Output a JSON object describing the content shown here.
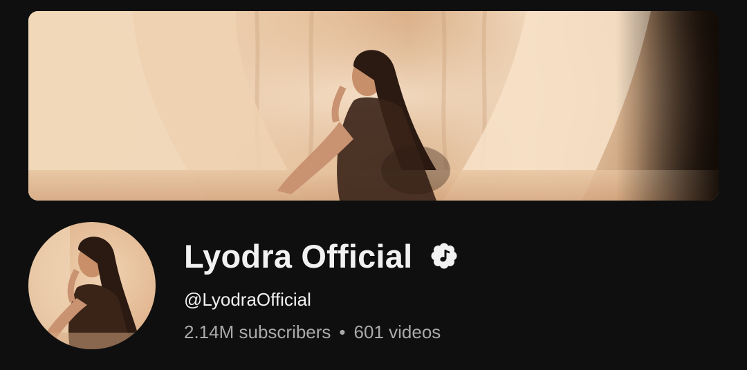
{
  "banner": {
    "image": "channel-banner-photo"
  },
  "avatar": {
    "image": "channel-avatar-photo"
  },
  "channel": {
    "name": "Lyodra Official",
    "handle": "@LyodraOfficial",
    "verified_icon": "official-artist-music-note-icon",
    "subscribers": "2.14M subscribers",
    "separator": "•",
    "videos": "601 videos"
  },
  "colors": {
    "background": "#0f0f0f",
    "primary_text": "#f1f1f1",
    "secondary_text": "#aaaaaa"
  }
}
